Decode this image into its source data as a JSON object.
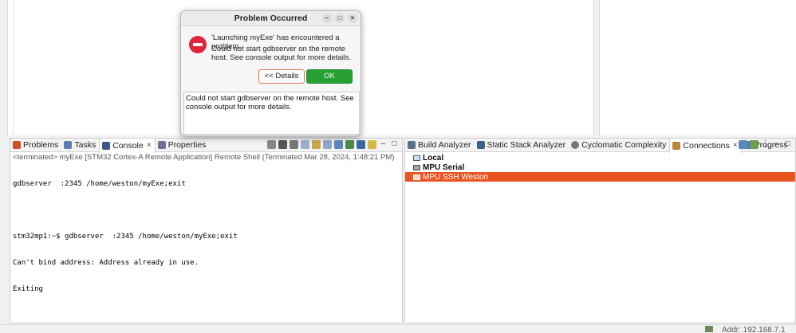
{
  "dialog": {
    "title": "Problem Occurred",
    "message": "'Launching myExe' has encountered a problem.",
    "detail_message": "Could not start gdbserver on the remote host. See console output for more details.",
    "details_button": "<< Details",
    "ok_button": "OK",
    "details_text": "Could not start gdbserver on the remote host. See console output for more details.",
    "minimize_glyph": "–",
    "maximize_glyph": "□",
    "close_glyph": "×"
  },
  "left_panel": {
    "tabs": [
      {
        "label": "Problems",
        "icon": "problems-icon"
      },
      {
        "label": "Tasks",
        "icon": "tasks-icon"
      },
      {
        "label": "Console",
        "icon": "console-icon",
        "close": "×"
      },
      {
        "label": "Properties",
        "icon": "properties-icon"
      }
    ],
    "console_header": "<terminated> myExe [STM32 Cortex-A Remote Application] Remote Shell (Terminated Mar 28, 2024, 1:48:21 PM)",
    "console_lines": [
      "gdbserver  :2345 /home/weston/myExe;exit",
      "",
      "stm32mp1:~$ gdbserver  :2345 /home/weston/myExe;exit",
      "Can't bind address: Address already in use.",
      "Exiting"
    ]
  },
  "right_panel": {
    "tabs": [
      {
        "label": "Build Analyzer",
        "icon": "build-analyzer-icon"
      },
      {
        "label": "Static Stack Analyzer",
        "icon": "stack-analyzer-icon"
      },
      {
        "label": "Cyclomatic Complexity",
        "icon": "complexity-icon"
      },
      {
        "label": "Connections",
        "icon": "connections-icon",
        "close": "×"
      },
      {
        "label": "Progress",
        "icon": "progress-icon"
      }
    ],
    "connections": [
      {
        "label": "Local"
      },
      {
        "label": "MPU Serial"
      },
      {
        "label": "MPU SSH Weston",
        "selected": true
      }
    ]
  },
  "status_bar": {
    "address": "Addr: 192.168.7.1"
  },
  "colors": {
    "selection": "#e95420",
    "ok_button": "#26a033",
    "error_icon": "#e0263a"
  }
}
